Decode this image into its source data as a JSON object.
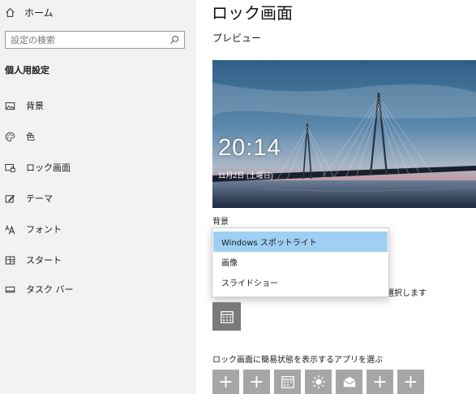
{
  "sidebar": {
    "home_label": "ホーム",
    "search_placeholder": "設定の検索",
    "section_title": "個人用設定",
    "items": [
      {
        "label": "背景",
        "icon": "picture-icon"
      },
      {
        "label": "色",
        "icon": "palette-icon"
      },
      {
        "label": "ロック画面",
        "icon": "lock-screen-icon"
      },
      {
        "label": "テーマ",
        "icon": "theme-icon"
      },
      {
        "label": "フォント",
        "icon": "font-icon"
      },
      {
        "label": "スタート",
        "icon": "start-icon"
      },
      {
        "label": "タスク バー",
        "icon": "taskbar-icon"
      }
    ]
  },
  "main": {
    "title": "ロック画面",
    "preview_label": "プレビュー",
    "preview_time": "20:14",
    "preview_date": "11月2日 (土曜日)",
    "background_label": "背景",
    "background_options": [
      "Windows スポットライト",
      "画像",
      "スライドショー"
    ],
    "background_selected": "Windows スポットライト",
    "choose_app_partial": "選択します",
    "apps_label": "ロック画面に簡易状態を表示するアプリを選ぶ",
    "app_slots": [
      "plus-icon",
      "plus-icon",
      "calendar-icon",
      "weather-icon",
      "mail-icon",
      "plus-icon",
      "plus-icon"
    ],
    "plus_glyph": "+"
  },
  "colors": {
    "sidebar_bg": "#f2f2f2",
    "selected_option": "#9fd0f3",
    "app_button": "#a6a6a6",
    "detailed_app_button": "#7a7a7a"
  }
}
